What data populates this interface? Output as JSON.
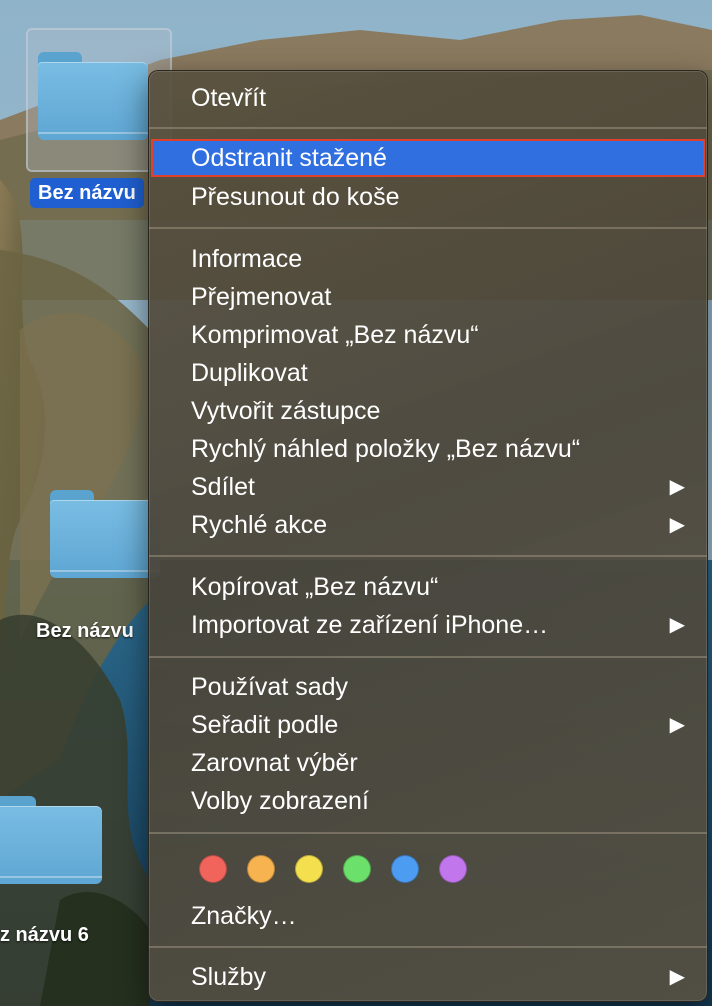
{
  "desktop": {
    "icons": [
      {
        "label": "Bez názvu",
        "selected": true
      },
      {
        "label": "Bez názvu"
      },
      {
        "label": "z názvu 6"
      }
    ]
  },
  "menu": {
    "items": [
      {
        "label": "Otevřít"
      },
      {
        "label": "Odstranit stažené",
        "highlighted": true
      },
      {
        "label": "Přesunout do koše"
      },
      {
        "label": "Informace"
      },
      {
        "label": "Přejmenovat"
      },
      {
        "label": "Komprimovat „Bez názvu“"
      },
      {
        "label": "Duplikovat"
      },
      {
        "label": "Vytvořit zástupce"
      },
      {
        "label": "Rychlý náhled položky „Bez názvu“"
      },
      {
        "label": "Sdílet",
        "submenu": true
      },
      {
        "label": "Rychlé akce",
        "submenu": true
      },
      {
        "label": "Kopírovat „Bez názvu“"
      },
      {
        "label": "Importovat ze zařízení iPhone…",
        "submenu": true
      },
      {
        "label": "Používat sady"
      },
      {
        "label": "Seřadit podle",
        "submenu": true
      },
      {
        "label": "Zarovnat výběr"
      },
      {
        "label": "Volby zobrazení"
      },
      {
        "label": "Značky…"
      },
      {
        "label": "Služby",
        "submenu": true
      }
    ],
    "submenu_arrow": "▶",
    "tag_colors": [
      {
        "name": "red-tag",
        "color": "#f0645c"
      },
      {
        "name": "orange-tag",
        "color": "#f6b34f"
      },
      {
        "name": "yellow-tag",
        "color": "#f4e04f"
      },
      {
        "name": "green-tag",
        "color": "#6be06a"
      },
      {
        "name": "blue-tag",
        "color": "#4c9cf2"
      },
      {
        "name": "purple-tag",
        "color": "#c276ec"
      }
    ],
    "highlight_color": "#2f6fe0",
    "highlight_outline_color": "#e0412f"
  }
}
